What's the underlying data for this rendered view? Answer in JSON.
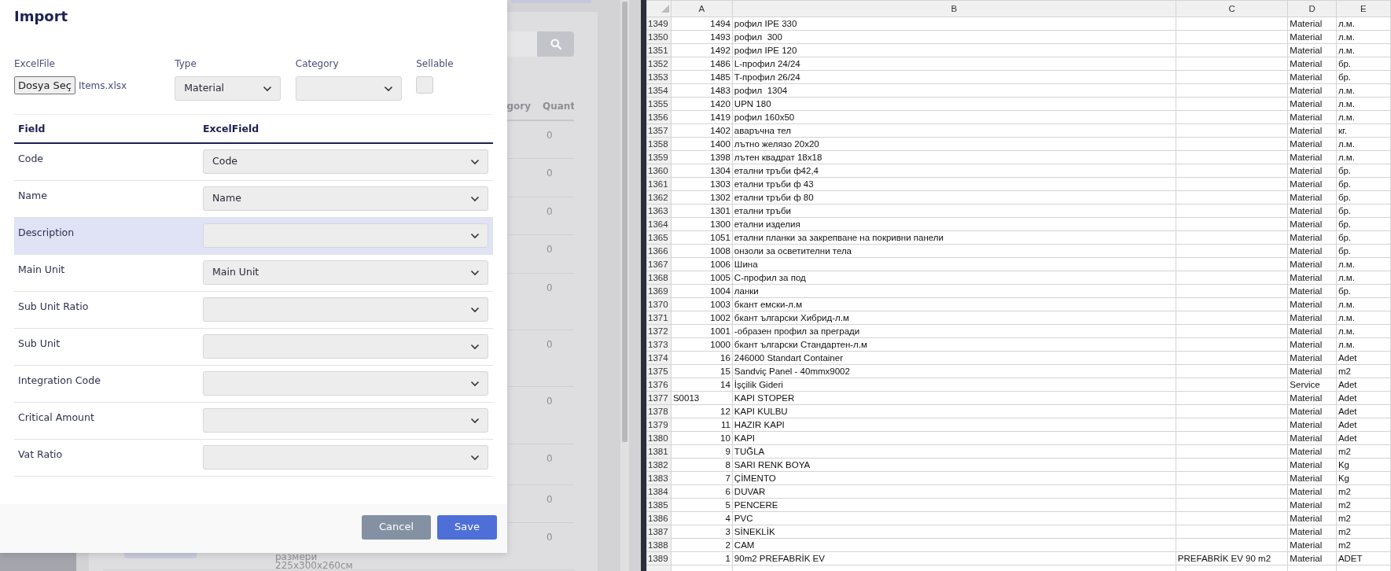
{
  "background_page": {
    "table": {
      "columns": [
        "gory",
        "Quant"
      ],
      "rows": [
        {
          "quantity": "0"
        },
        {
          "quantity": "0"
        },
        {
          "quantity": "0"
        },
        {
          "quantity": "0"
        },
        {
          "quantity": "0"
        },
        {
          "quantity": "0"
        },
        {
          "quantity": "0"
        },
        {
          "quantity": "0"
        },
        {
          "quantity": "0"
        },
        {
          "quantity": "0",
          "description": [
            "размери",
            "225x300x260см"
          ]
        }
      ]
    }
  },
  "modal": {
    "title": "Import",
    "fields": [
      {
        "label": "ExcelFile",
        "kind": "file",
        "button": "Dosya Seç",
        "value": "Items.xlsx"
      },
      {
        "label": "Type",
        "kind": "select",
        "value": "Material"
      },
      {
        "label": "Category",
        "kind": "select"
      },
      {
        "label": "Sellable",
        "kind": "checkbox",
        "checked": false
      }
    ],
    "mapping": {
      "columns": [
        "Field",
        "ExcelField"
      ],
      "rows": [
        {
          "field": "Code",
          "excel_field": "Code",
          "selected": false
        },
        {
          "field": "Name",
          "excel_field": "Name",
          "selected": false
        },
        {
          "field": "Description",
          "selected": true
        },
        {
          "field": "Main Unit",
          "excel_field": "Main Unit",
          "selected": false
        },
        {
          "field": "Sub Unit Ratio",
          "selected": false
        },
        {
          "field": "Sub Unit",
          "selected": false
        },
        {
          "field": "Integration Code",
          "selected": false
        },
        {
          "field": "Critical Amount",
          "selected": false
        },
        {
          "field": "Vat Ratio",
          "selected": false
        }
      ]
    },
    "buttons": [
      {
        "label": "Cancel",
        "kind": "secondary"
      },
      {
        "label": "Save",
        "kind": "primary"
      }
    ]
  },
  "spreadsheet": {
    "columns": [
      "A",
      "B",
      "C",
      "D",
      "E"
    ],
    "rows": [
      {
        "n": "1349",
        "a": "1494",
        "b": "рофил IPE 330",
        "d": "Material",
        "e": "л.м.",
        "kind": "number"
      },
      {
        "n": "1350",
        "a": "1493",
        "b": "рофил  300",
        "d": "Material",
        "e": "л.м.",
        "kind": "number"
      },
      {
        "n": "1351",
        "a": "1492",
        "b": "рофил IPE 120",
        "d": "Material",
        "e": "л.м.",
        "kind": "number"
      },
      {
        "n": "1352",
        "a": "1486",
        "b": "L-профил 24/24",
        "d": "Material",
        "e": "бр.",
        "kind": "number"
      },
      {
        "n": "1353",
        "a": "1485",
        "b": "T-профил 26/24",
        "d": "Material",
        "e": "бр.",
        "kind": "number"
      },
      {
        "n": "1354",
        "a": "1483",
        "b": "рофил  1304",
        "d": "Material",
        "e": "л.м.",
        "kind": "number"
      },
      {
        "n": "1355",
        "a": "1420",
        "b": "UPN 180",
        "d": "Material",
        "e": "л.м.",
        "kind": "number"
      },
      {
        "n": "1356",
        "a": "1419",
        "b": "рофил 160x50",
        "d": "Material",
        "e": "л.м.",
        "kind": "number"
      },
      {
        "n": "1357",
        "a": "1402",
        "b": "аваръчна тел",
        "d": "Material",
        "e": "кг.",
        "kind": "number"
      },
      {
        "n": "1358",
        "a": "1400",
        "b": "лътно желязо 20x20",
        "d": "Material",
        "e": "л.м.",
        "kind": "number"
      },
      {
        "n": "1359",
        "a": "1398",
        "b": "лътен квадрат 18x18",
        "d": "Material",
        "e": "л.м.",
        "kind": "number"
      },
      {
        "n": "1360",
        "a": "1304",
        "b": "етални тръби ф42,4",
        "d": "Material",
        "e": "бр.",
        "kind": "number"
      },
      {
        "n": "1361",
        "a": "1303",
        "b": "етални тръби ф 43",
        "d": "Material",
        "e": "бр.",
        "kind": "number"
      },
      {
        "n": "1362",
        "a": "1302",
        "b": "етални тръби ф 80",
        "d": "Material",
        "e": "бр.",
        "kind": "number"
      },
      {
        "n": "1363",
        "a": "1301",
        "b": "етални тръби",
        "d": "Material",
        "e": "бр.",
        "kind": "number"
      },
      {
        "n": "1364",
        "a": "1300",
        "b": "етални изделия",
        "d": "Material",
        "e": "бр.",
        "kind": "number"
      },
      {
        "n": "1365",
        "a": "1051",
        "b": "етални планки за закрепване на покривни панели",
        "d": "Material",
        "e": "бр.",
        "kind": "number"
      },
      {
        "n": "1366",
        "a": "1008",
        "b": "онзоли за осветителни тела",
        "d": "Material",
        "e": "бр.",
        "kind": "number"
      },
      {
        "n": "1367",
        "a": "1006",
        "b": "Шина",
        "d": "Material",
        "e": "л.м.",
        "kind": "number"
      },
      {
        "n": "1368",
        "a": "1005",
        "b": "С-профил за под",
        "d": "Material",
        "e": "л.м.",
        "kind": "number"
      },
      {
        "n": "1369",
        "a": "1004",
        "b": "ланки",
        "d": "Material",
        "e": "бр.",
        "kind": "number"
      },
      {
        "n": "1370",
        "a": "1003",
        "b": "бкант емски-л.м",
        "d": "Material",
        "e": "л.м.",
        "kind": "number"
      },
      {
        "n": "1371",
        "a": "1002",
        "b": "бкант ългарски Хибрид-л.м",
        "d": "Material",
        "e": "л.м.",
        "kind": "number"
      },
      {
        "n": "1372",
        "a": "1001",
        "b": "-образен профил за прегради",
        "d": "Material",
        "e": "л.м.",
        "kind": "number"
      },
      {
        "n": "1373",
        "a": "1000",
        "b": "бкант ългарски Стандартен-л.м",
        "d": "Material",
        "e": "л.м.",
        "kind": "number"
      },
      {
        "n": "1374",
        "a": "16",
        "b": "246000 Standart Container",
        "d": "Material",
        "e": "Adet",
        "kind": "number"
      },
      {
        "n": "1375",
        "a": "15",
        "b": "Sandviç Panel - 40mmx9002",
        "d": "Material",
        "e": "m2",
        "kind": "number"
      },
      {
        "n": "1376",
        "a": "14",
        "b": "İşçilik Gideri",
        "d": "Service",
        "e": "Adet",
        "kind": "number"
      },
      {
        "n": "1377",
        "a": "S0013",
        "b": "KAPI STOPER",
        "d": "Material",
        "e": "Adet",
        "kind": "text"
      },
      {
        "n": "1378",
        "a": "12",
        "b": "KAPI KULBU",
        "d": "Material",
        "e": "Adet",
        "kind": "number"
      },
      {
        "n": "1379",
        "a": "11",
        "b": "HAZIR KAPI",
        "d": "Material",
        "e": "Adet",
        "kind": "number"
      },
      {
        "n": "1380",
        "a": "10",
        "b": "KAPI",
        "d": "Material",
        "e": "Adet",
        "kind": "number"
      },
      {
        "n": "1381",
        "a": "9",
        "b": "TUĞLA",
        "d": "Material",
        "e": "m2",
        "kind": "number"
      },
      {
        "n": "1382",
        "a": "8",
        "b": "SARI RENK BOYA",
        "d": "Material",
        "e": "Kg",
        "kind": "number"
      },
      {
        "n": "1383",
        "a": "7",
        "b": "ÇİMENTO",
        "d": "Material",
        "e": "Kg",
        "kind": "number"
      },
      {
        "n": "1384",
        "a": "6",
        "b": "DUVAR",
        "d": "Material",
        "e": "m2",
        "kind": "number"
      },
      {
        "n": "1385",
        "a": "5",
        "b": "PENCERE",
        "d": "Material",
        "e": "m2",
        "kind": "number"
      },
      {
        "n": "1386",
        "a": "4",
        "b": "PVC",
        "d": "Material",
        "e": "m2",
        "kind": "number"
      },
      {
        "n": "1387",
        "a": "3",
        "b": "SİNEKLİK",
        "d": "Material",
        "e": "m2",
        "kind": "number"
      },
      {
        "n": "1388",
        "a": "2",
        "b": "CAM",
        "d": "Material",
        "e": "m2",
        "kind": "number"
      },
      {
        "n": "1389",
        "a": "1",
        "b": "90m2 PREFABRİK EV",
        "c": "PREFABRİK EV 90 m2",
        "d": "Material",
        "e": "ADET",
        "kind": "number"
      }
    ]
  }
}
